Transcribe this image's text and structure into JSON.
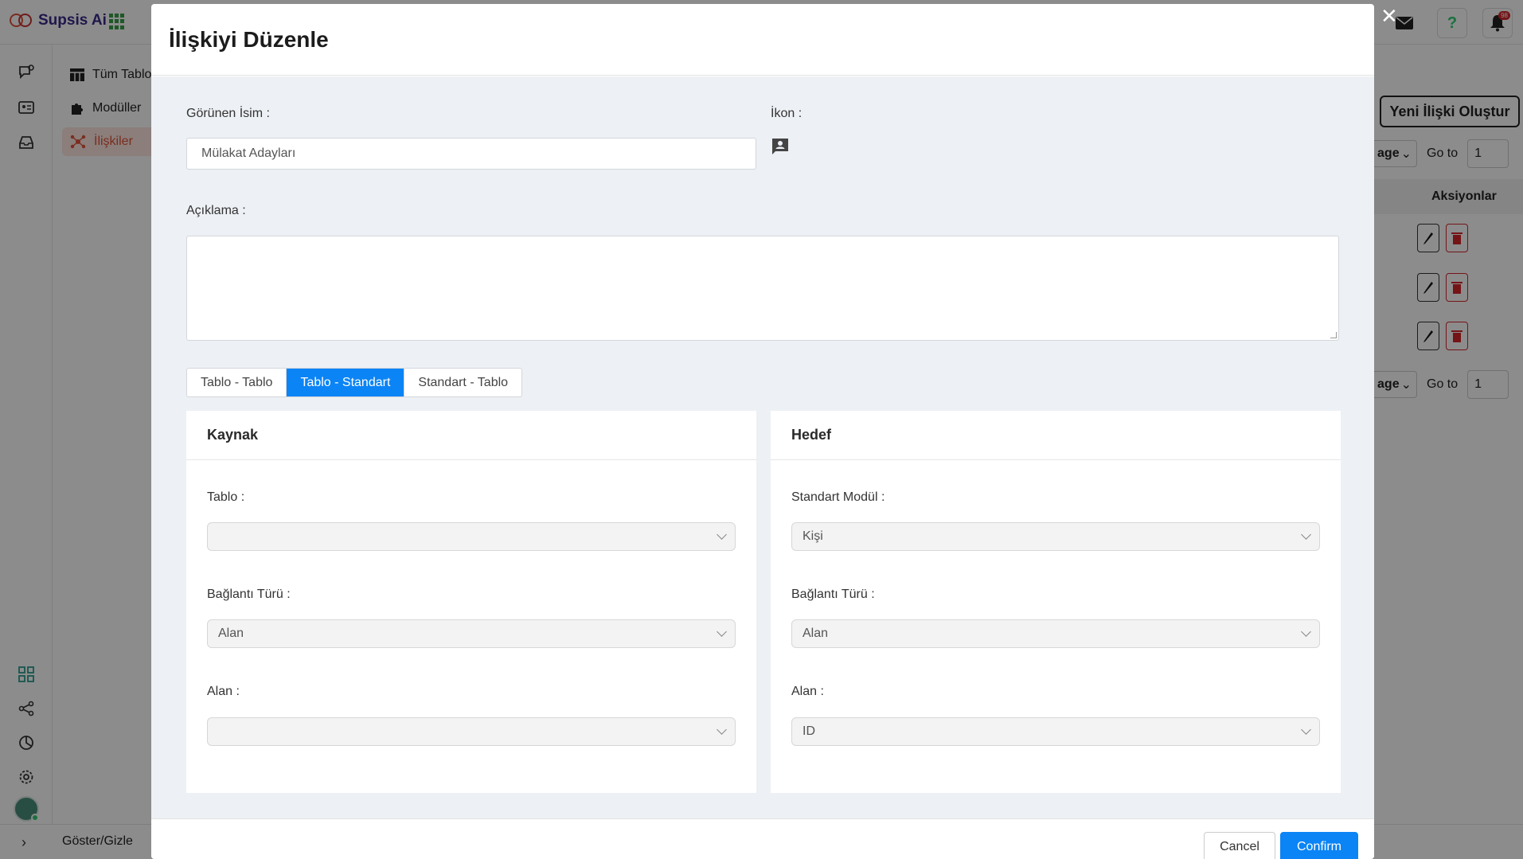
{
  "app": {
    "logo_text": "Supsis Ai",
    "notification_count": "98"
  },
  "subnav": {
    "items": [
      {
        "label": "Tüm Tablolar"
      },
      {
        "label": "Modüller"
      },
      {
        "label": "İlişkiler"
      }
    ]
  },
  "background": {
    "new_relation_button": "Yeni İlişki Oluştur",
    "page_select": "age",
    "goto_label": "Go to",
    "goto_value": "1",
    "actions_header": "Aksiyonlar"
  },
  "footer_toggle": "Göster/Gizle",
  "modal": {
    "title": "İlişkiyi Düzenle",
    "display_name_label": "Görünen İsim",
    "display_name_value": "Mülakat Adayları",
    "icon_label": "İkon",
    "description_label": "Açıklama",
    "description_value": "",
    "tabs": [
      {
        "label": "Tablo - Tablo",
        "active": false
      },
      {
        "label": "Tablo - Standart",
        "active": true
      },
      {
        "label": "Standart - Tablo",
        "active": false
      }
    ],
    "source": {
      "title": "Kaynak",
      "table_label": "Tablo",
      "table_value": "",
      "connection_type_label": "Bağlantı Türü",
      "connection_type_value": "Alan",
      "field_label": "Alan",
      "field_value": ""
    },
    "target": {
      "title": "Hedef",
      "standard_module_label": "Standart Modül",
      "standard_module_value": "Kişi",
      "connection_type_label": "Bağlantı Türü",
      "connection_type_value": "Alan",
      "field_label": "Alan",
      "field_value": "ID"
    },
    "cancel_label": "Cancel",
    "confirm_label": "Confirm"
  },
  "colors": {
    "accent": "#0b84f5",
    "brand": "#e0533a",
    "danger": "#d6262a"
  }
}
